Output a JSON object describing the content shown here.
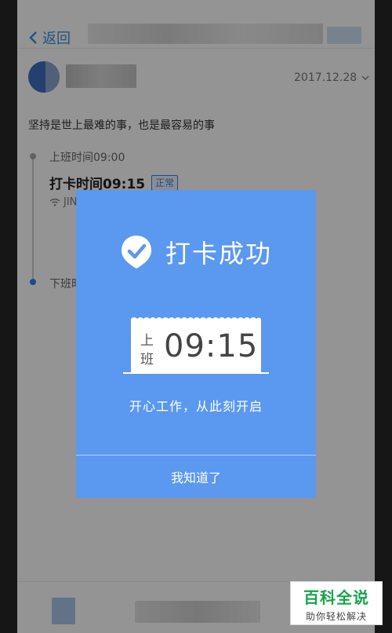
{
  "header": {
    "back_label": "返回"
  },
  "post": {
    "date": "2017.12.28",
    "motto": "坚持是世上最难的事，也是最容易的事"
  },
  "timeline": {
    "work_start_label": "上班时间09:00",
    "clock_time": "打卡时间09:15",
    "status_badge": "正常",
    "wifi_text": "JIN",
    "work_end_label": "下班时"
  },
  "dialog": {
    "title": "打卡成功",
    "ticket_label": "上班",
    "ticket_time": "09:15",
    "subtitle": "开心工作，从此刻开启",
    "confirm_label": "我知道了"
  },
  "watermark": {
    "title": "百科全说",
    "subtitle": "助你轻松解决"
  },
  "colors": {
    "dialog_blue": "#5b98f0",
    "accent_blue": "#3a7ee6",
    "watermark_green": "#19a34a"
  },
  "icons": {
    "back": "chevron-left-icon",
    "date_dropdown": "chevron-down-icon",
    "wifi": "wifi-icon",
    "success": "check-badge-icon"
  }
}
